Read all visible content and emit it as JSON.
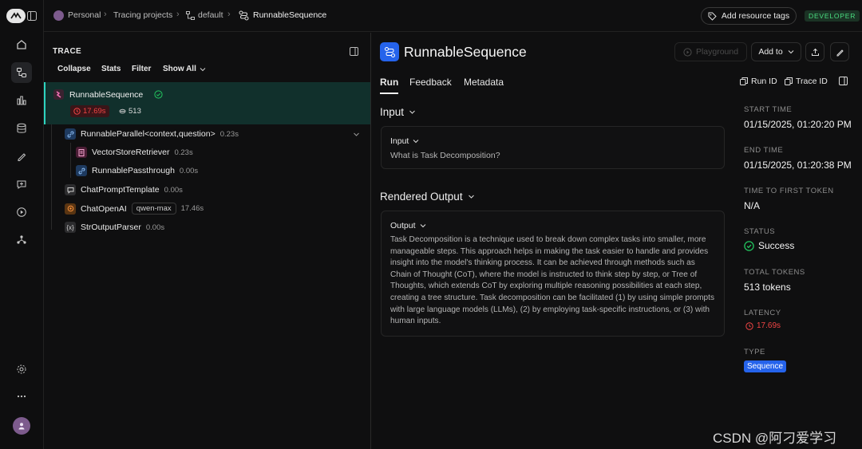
{
  "breadcrumb": {
    "personal": "Personal",
    "tracing_projects": "Tracing projects",
    "project": "default",
    "current": "RunnableSequence"
  },
  "topbar": {
    "add_tags": "Add resource tags",
    "env_badge": "DEVELOPER"
  },
  "trace": {
    "title": "TRACE",
    "toolbar": {
      "collapse": "Collapse",
      "stats": "Stats",
      "filter": "Filter",
      "show": "Show All"
    },
    "root": {
      "name": "RunnableSequence",
      "latency": "17.69s",
      "tokens": "513"
    },
    "nodes": [
      {
        "name": "RunnableParallel<context,question>",
        "duration": "0.23s"
      },
      {
        "name": "VectorStoreRetriever",
        "duration": "0.23s"
      },
      {
        "name": "RunnablePassthrough",
        "duration": "0.00s"
      },
      {
        "name": "ChatPromptTemplate",
        "duration": "0.00s"
      },
      {
        "name": "ChatOpenAI",
        "model": "qwen-max",
        "duration": "17.46s"
      },
      {
        "name": "StrOutputParser",
        "duration": "0.00s"
      }
    ]
  },
  "run": {
    "title": "RunnableSequence",
    "playground": "Playground",
    "add_to": "Add to",
    "tabs": [
      "Run",
      "Feedback",
      "Metadata"
    ],
    "run_id": "Run ID",
    "trace_id": "Trace ID",
    "input_section": "Input",
    "input_label": "Input",
    "input_text": "What is Task Decomposition?",
    "output_section": "Rendered Output",
    "output_label": "Output",
    "output_text": "Task Decomposition is a technique used to break down complex tasks into smaller, more manageable steps. This approach helps in making the task easier to handle and provides insight into the model's thinking process. It can be achieved through methods such as Chain of Thought (CoT), where the model is instructed to think step by step, or Tree of Thoughts, which extends CoT by exploring multiple reasoning possibilities at each step, creating a tree structure. Task decomposition can be facilitated (1) by using simple prompts with large language models (LLMs), (2) by employing task-specific instructions, or (3) with human inputs."
  },
  "meta": {
    "start_label": "START TIME",
    "start_value": "01/15/2025, 01:20:20 PM",
    "end_label": "END TIME",
    "end_value": "01/15/2025, 01:20:38 PM",
    "ttft_label": "TIME TO FIRST TOKEN",
    "ttft_value": "N/A",
    "status_label": "STATUS",
    "status_value": "Success",
    "tokens_label": "TOTAL TOKENS",
    "tokens_value": "513 tokens",
    "latency_label": "LATENCY",
    "latency_value": "17.69s",
    "type_label": "TYPE",
    "type_value": "Sequence"
  },
  "watermark": "CSDN @阿刁爱学习",
  "colors": {
    "accent_blue": "#2563eb",
    "success_green": "#22c55e",
    "latency_red": "#ef4444",
    "selected_row": "#11302c"
  }
}
